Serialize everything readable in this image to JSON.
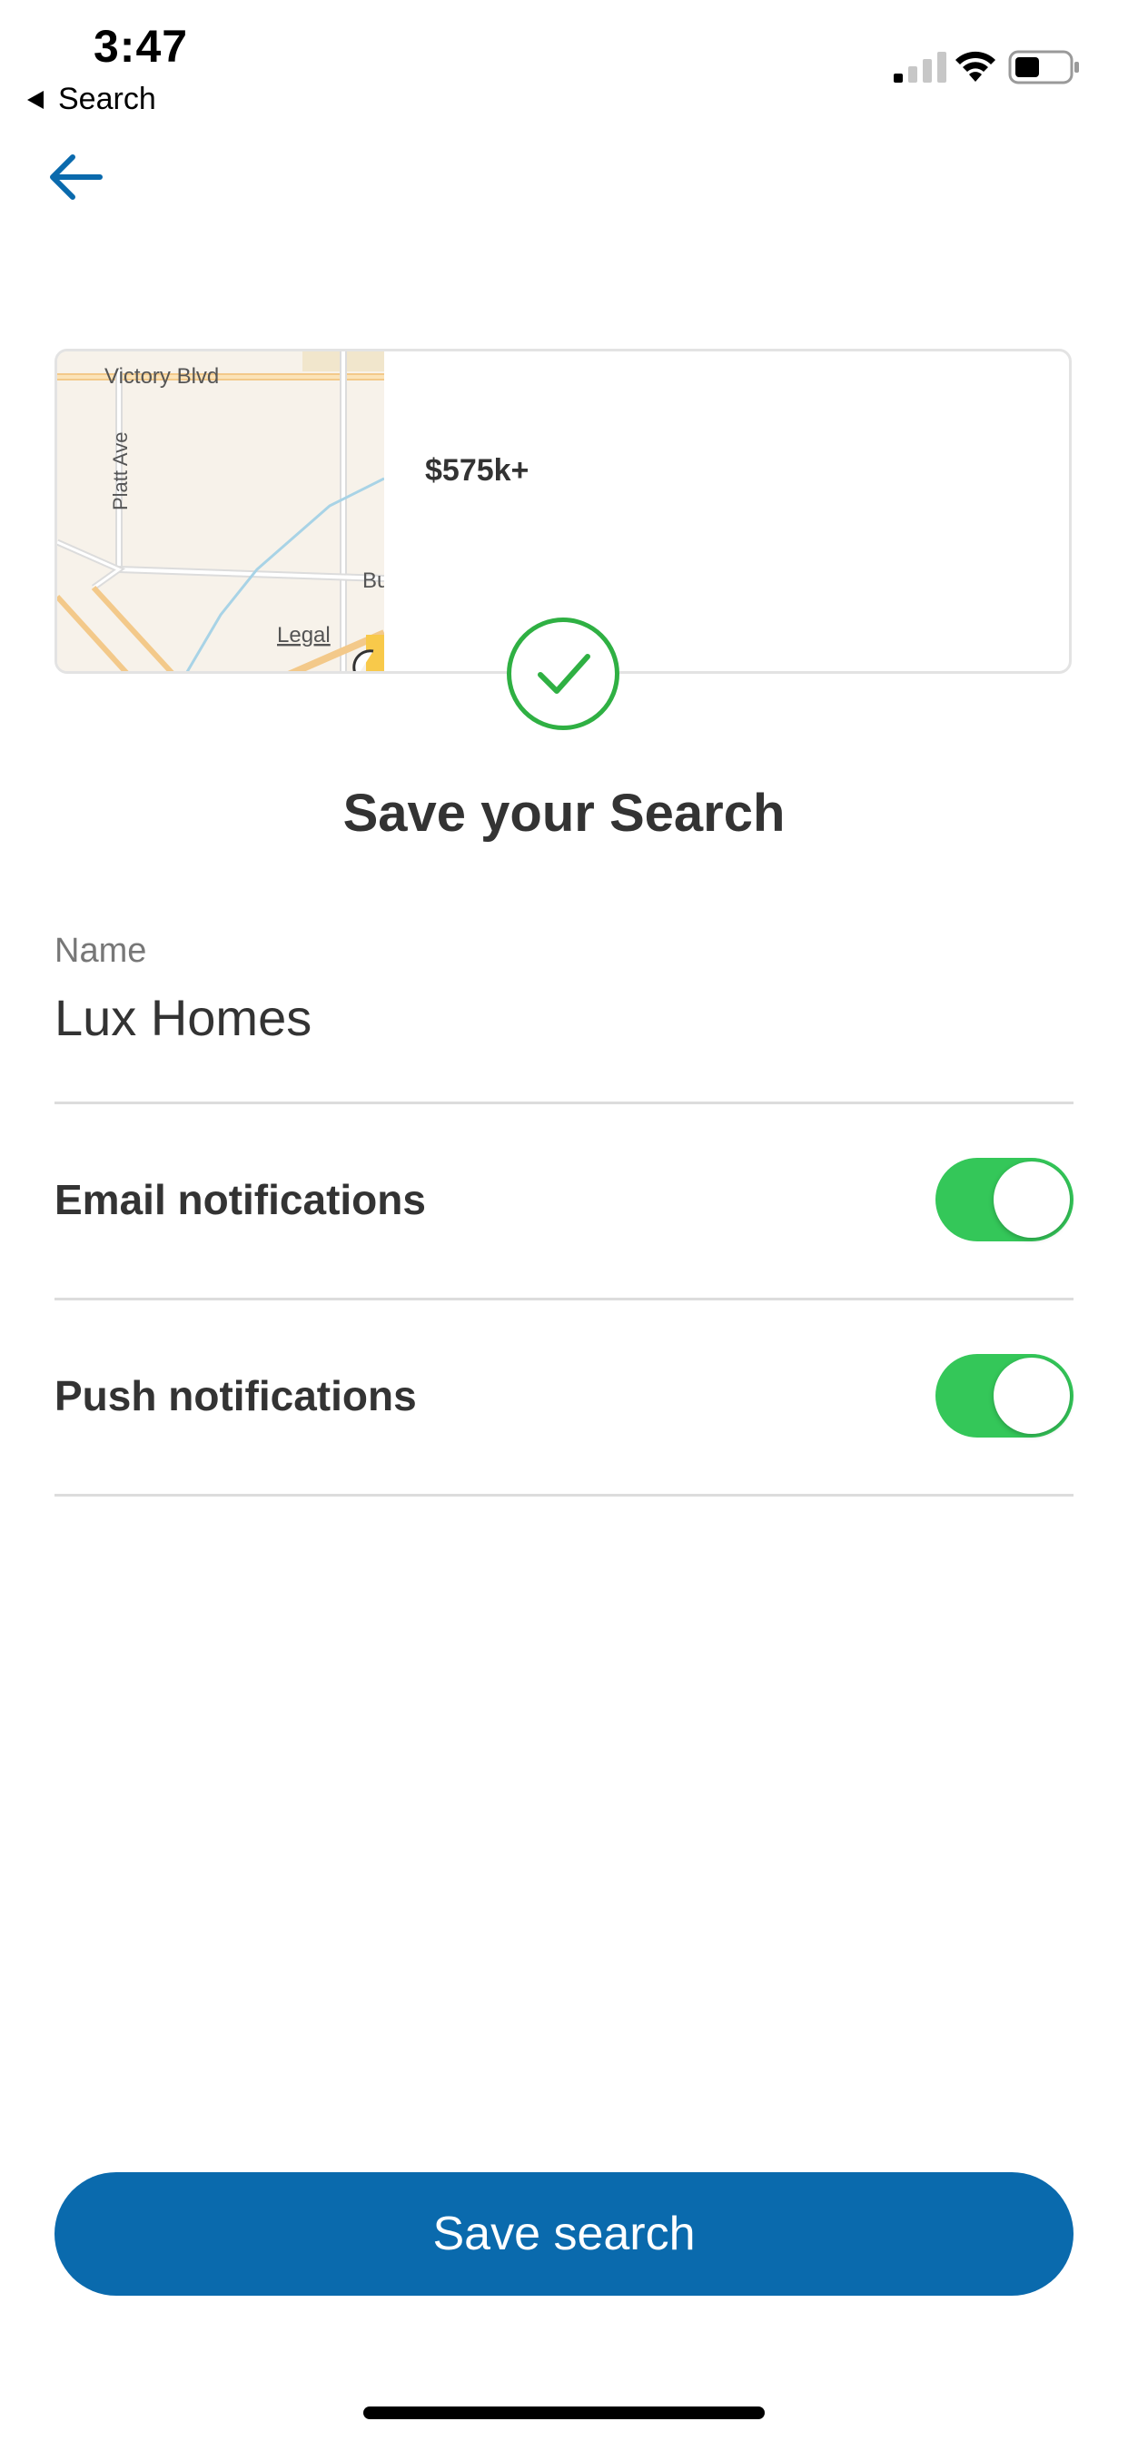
{
  "status_bar": {
    "time": "3:47",
    "back_label": "Search",
    "icons": [
      "signal-icon",
      "wifi-icon",
      "battery-icon"
    ]
  },
  "header": {
    "back_icon": "arrow-left-icon",
    "accent_color": "#0a6aad"
  },
  "preview": {
    "map_labels": [
      "Victory Blvd",
      "Platt Ave",
      "Bu",
      "Legal"
    ],
    "price": "$575k+",
    "check_icon": "check-circle-icon",
    "check_color": "#2fb043"
  },
  "title": "Save your Search",
  "form": {
    "name_label": "Name",
    "name_value": "Lux Homes",
    "email_notifications_label": "Email notifications",
    "email_notifications_on": true,
    "push_notifications_label": "Push notifications",
    "push_notifications_on": true,
    "toggle_on_color": "#34c759"
  },
  "save_button_label": "Save search"
}
